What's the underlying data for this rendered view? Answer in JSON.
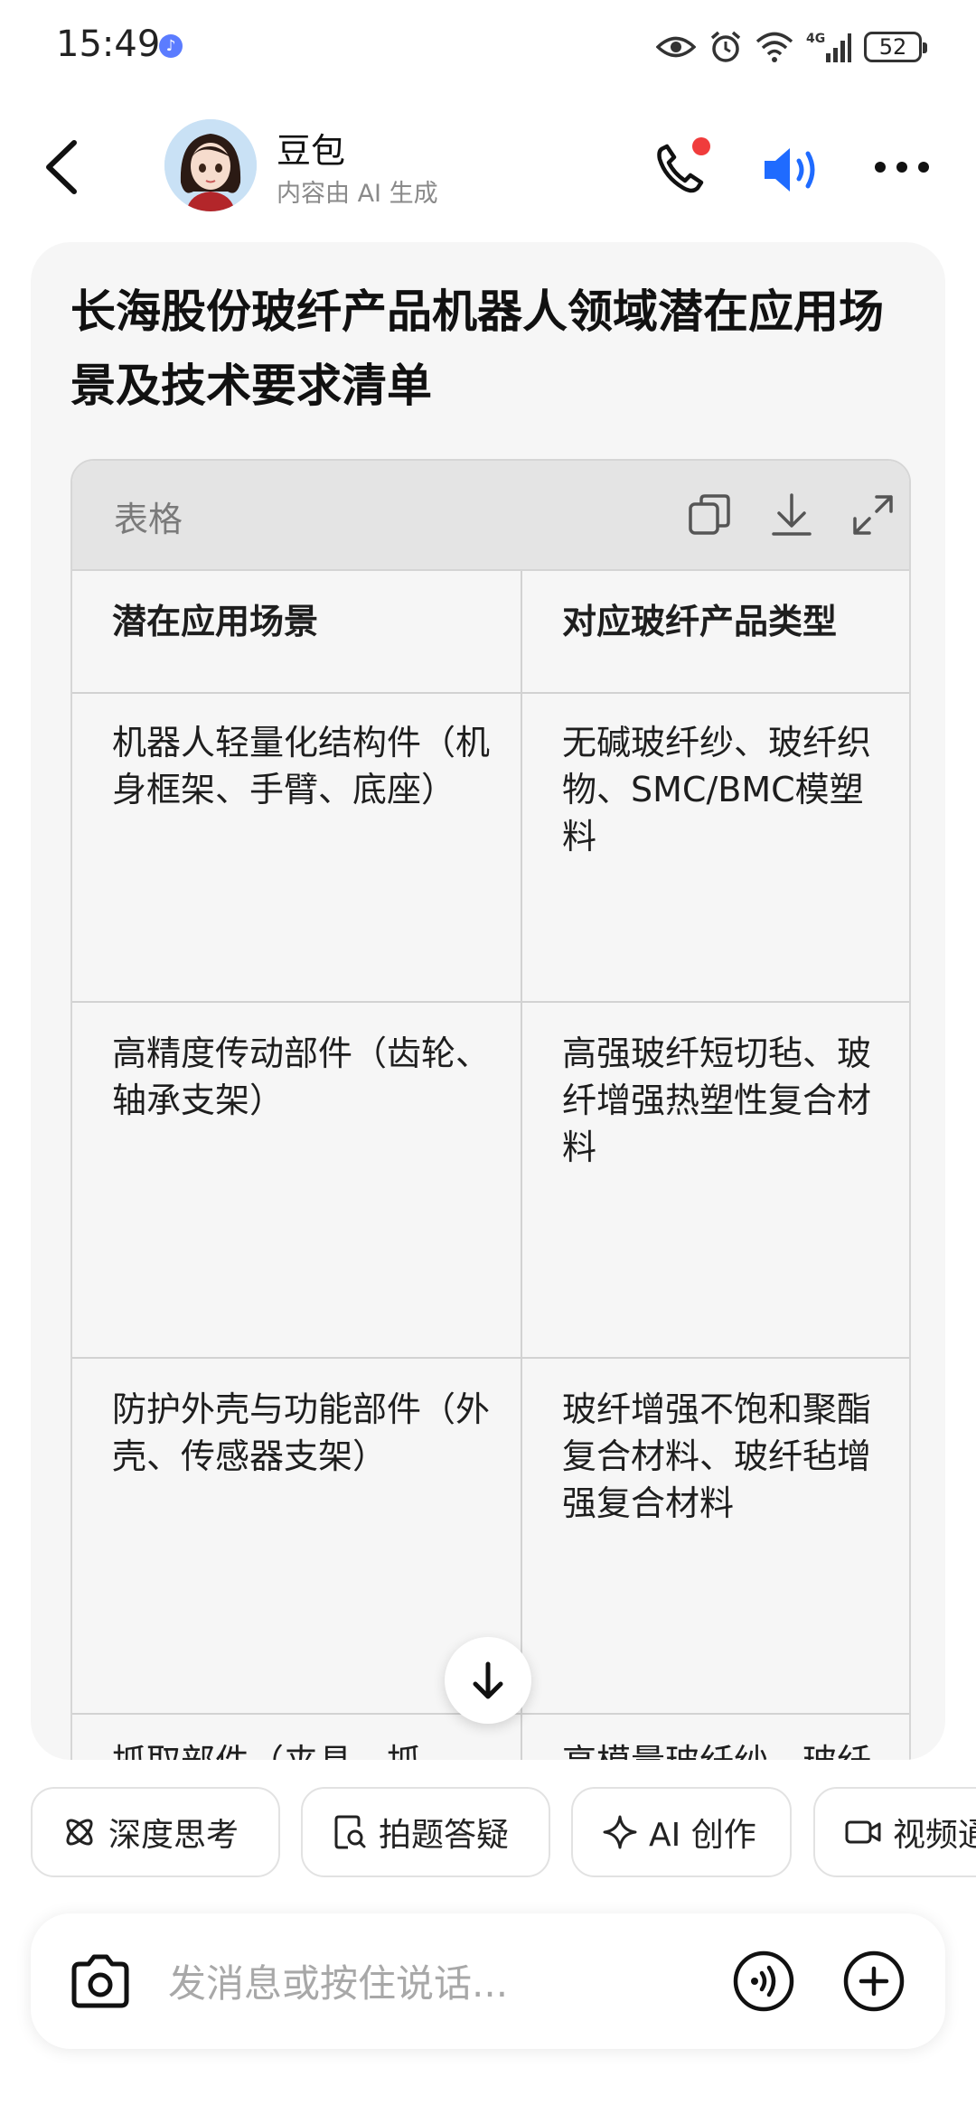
{
  "status_bar": {
    "time": "15:49",
    "network": "4G",
    "battery": "52"
  },
  "header": {
    "name": "豆包",
    "subtitle": "内容由 AI 生成"
  },
  "message": {
    "title": "长海股份玻纤产品机器人领域潜在应用场景及技术要求清单",
    "table": {
      "label": "表格",
      "headers": [
        "潜在应用场景",
        "对应玻纤产品类型"
      ],
      "rows": [
        {
          "scene": "机器人轻量化结构件（机身框架、手臂、底座）",
          "product": [
            "无碱玻纤纱、玻纤织",
            "物、SMC/BMC模塑",
            "料"
          ]
        },
        {
          "scene": "高精度传动部件（齿轮、轴承支架）",
          "product": [
            "高强玻纤短切毡、玻",
            "纤增强热塑性复合材",
            "料"
          ]
        },
        {
          "scene": "防护外壳与功能部件（外壳、传感器支架）",
          "product": [
            "玻纤增强不饱和聚酯",
            "复合材料、玻纤毡增",
            "强复合材料"
          ]
        },
        {
          "scene": "抓取部件（夹具、抓",
          "product": [
            "高模量玻纤纱、玻纤"
          ]
        }
      ]
    }
  },
  "chips": [
    "深度思考",
    "拍题答疑",
    "AI 创作",
    "视频通话"
  ],
  "input": {
    "placeholder": "发消息或按住说话..."
  },
  "colors": {
    "accent": "#1f6bff",
    "notification": "#f03c3c"
  }
}
